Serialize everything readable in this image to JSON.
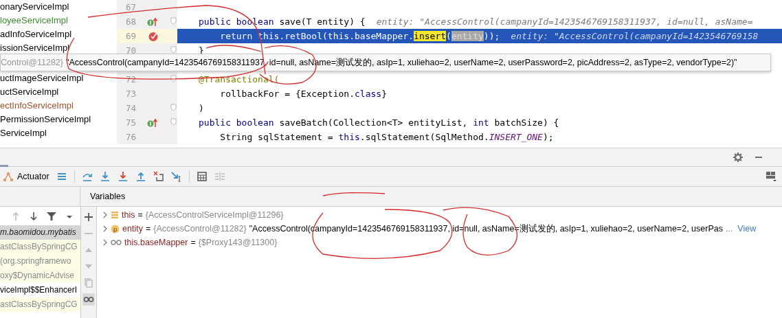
{
  "project_tree": {
    "items": [
      {
        "text": "onaryServiceImpl",
        "color": "#000000"
      },
      {
        "text": "loyeeServiceImpl",
        "color": "#3b8a2e"
      },
      {
        "text": "adInfoServiceImpl",
        "color": "#000000"
      },
      {
        "text": "issionServiceImpl",
        "color": "#000000"
      }
    ],
    "items_below_popup": [
      {
        "text": "uctImageServiceImpl",
        "color": "#000000"
      },
      {
        "text": "uctServiceImpl",
        "color": "#000000"
      },
      {
        "text": "ectInfoServiceImpl",
        "color": "#a0522d"
      },
      {
        "text": "PermissionServiceImpl",
        "color": "#000000"
      },
      {
        "text": "ServiceImpl",
        "color": "#000000"
      }
    ]
  },
  "editor": {
    "lines": [
      {
        "number": "67",
        "fold": false,
        "current": false
      },
      {
        "number": "68",
        "gutter_icon": {
          "kind": "implements"
        },
        "fold": true,
        "current": false,
        "tokens": [
          {
            "text": "public boolean ",
            "kind": "keyword"
          },
          {
            "text": "save(T entity) {",
            "kind": "plain"
          },
          {
            "text": "entity: \"AccessControl(campanyId=1423546769158311937, id=null, asName=",
            "kind": "hint"
          }
        ]
      },
      {
        "number": "69",
        "gutter_icon": {
          "kind": "breakpoint"
        },
        "fold": false,
        "current": true,
        "tokens": [
          {
            "text": "    return this",
            "kind": "keyword"
          },
          {
            "text": ".retBool(",
            "kind": "plain"
          },
          {
            "text": "this",
            "kind": "keyword"
          },
          {
            "text": ".baseMapper.",
            "kind": "plain"
          },
          {
            "text": "insert",
            "kind": "match"
          },
          {
            "text": "(",
            "kind": "plain"
          },
          {
            "text": "entity",
            "kind": "usage"
          },
          {
            "text": "));",
            "kind": "plain"
          },
          {
            "text": "entity: \"AccessControl(campanyId=1423546769158",
            "kind": "hint"
          }
        ]
      },
      {
        "number": "70",
        "fold": true,
        "current": false,
        "tokens": [
          {
            "text": "}",
            "kind": "plain"
          }
        ]
      }
    ],
    "lines_below_popup": [
      {
        "number": "72",
        "fold": true,
        "current": false,
        "tokens": [
          {
            "text": "@Transactional(",
            "kind": "annotation"
          }
        ]
      },
      {
        "number": "73",
        "fold": false,
        "current": false,
        "tokens": [
          {
            "text": "    rollbackFor = {Exception.",
            "kind": "plain"
          },
          {
            "text": "class",
            "kind": "keyword"
          },
          {
            "text": "}",
            "kind": "plain"
          }
        ]
      },
      {
        "number": "74",
        "fold": true,
        "current": false,
        "tokens": [
          {
            "text": ")",
            "kind": "plain"
          }
        ]
      },
      {
        "number": "75",
        "gutter_icon": {
          "kind": "implements"
        },
        "fold": true,
        "current": false,
        "tokens": [
          {
            "text": "public boolean ",
            "kind": "keyword"
          },
          {
            "text": "saveBatch(Collection<T> entityList, ",
            "kind": "plain"
          },
          {
            "text": "int ",
            "kind": "keyword"
          },
          {
            "text": "batchSize) {",
            "kind": "plain"
          }
        ]
      },
      {
        "number": "76",
        "fold": false,
        "current": false,
        "tokens": [
          {
            "text": "    String sqlStatement = ",
            "kind": "plain"
          },
          {
            "text": "this",
            "kind": "keyword"
          },
          {
            "text": ".sqlStatement(SqlMethod.",
            "kind": "plain"
          },
          {
            "text": "INSERT_ONE",
            "kind": "constant"
          },
          {
            "text": ");",
            "kind": "plain"
          }
        ]
      }
    ]
  },
  "popup": {
    "object_ref": "Control@11282}",
    "value": "\"AccessControl(campanyId=1423546769158311937, id=null, asName=测试发的, asIp=1, xuliehao=2, userName=2, userPassword=2, picAddress=2, asType=2, vendorType=2)\""
  },
  "debugger": {
    "actuator_tab": "Actuator",
    "variables_title": "Variables",
    "frames": [
      {
        "text": "m.baomidou.mybatis",
        "selected": true,
        "library": false
      },
      {
        "text": "astClassBySpringCG",
        "selected": false,
        "library": true
      },
      {
        "text": "(org.springframewo",
        "selected": false,
        "library": true
      },
      {
        "text": "oxy$DynamicAdvise",
        "selected": false,
        "library": true
      },
      {
        "text": "viceImpl$$EnhancerI",
        "selected": false,
        "library": false
      },
      {
        "text": "astClassBySpringCG",
        "selected": false,
        "library": true
      }
    ],
    "variables": [
      {
        "kind": "field",
        "name": "this",
        "operator": "=",
        "value": "{AccessControlServiceImpl@11296}"
      },
      {
        "kind": "parameter",
        "icon_letter": "p",
        "name": "entity",
        "operator": "=",
        "value": "{AccessControl@11282}",
        "string": "\"AccessControl(campanyId=1423546769158311937, id=null, asName=测试发的, asIp=1, xuliehao=2, userName=2, userPas",
        "more": "...",
        "link": "View"
      },
      {
        "kind": "watch",
        "name": "this.baseMapper",
        "operator": "=",
        "value": "{$Proxy143@11300}"
      }
    ]
  }
}
